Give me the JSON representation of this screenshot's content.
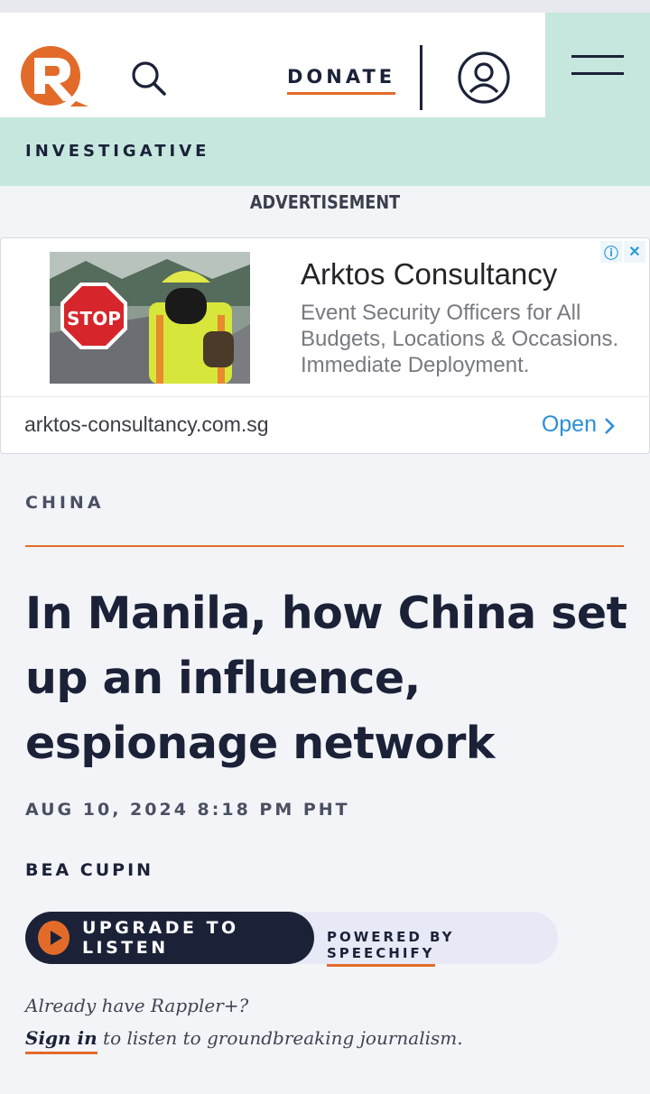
{
  "header": {
    "donate_label": "DONATE",
    "logo_name": "rappler-logo",
    "search_icon": "search-icon",
    "account_icon": "user-icon",
    "menu_icon": "hamburger-menu-icon"
  },
  "section": {
    "label": "INVESTIGATIVE"
  },
  "advertisement": {
    "label": "ADVERTISEMENT",
    "title": "Arktos Consultancy",
    "description": "Event Security Officers for All Budgets, Locations & Occasions. Immediate Deployment.",
    "url": "arktos-consultancy.com.sg",
    "cta": "Open",
    "image_sign_text": "STOP"
  },
  "article": {
    "category": "CHINA",
    "headline": "In Manila, how China set up an influence, espionage network",
    "date": "AUG 10, 2024 8:18 PM PHT",
    "author": "BEA CUPIN"
  },
  "audio": {
    "button_label": "UPGRADE TO LISTEN",
    "powered_prefix": "POWERED BY ",
    "powered_brand": "SPEECHIFY"
  },
  "subscribe": {
    "prompt": "Already have Rappler+?",
    "signin_link": "Sign in",
    "signin_rest": " to listen to groundbreaking journalism."
  },
  "colors": {
    "accent": "#e26b2a",
    "navy": "#1b2238",
    "mint": "#c5e7de",
    "ad_link": "#2c8fd6"
  }
}
